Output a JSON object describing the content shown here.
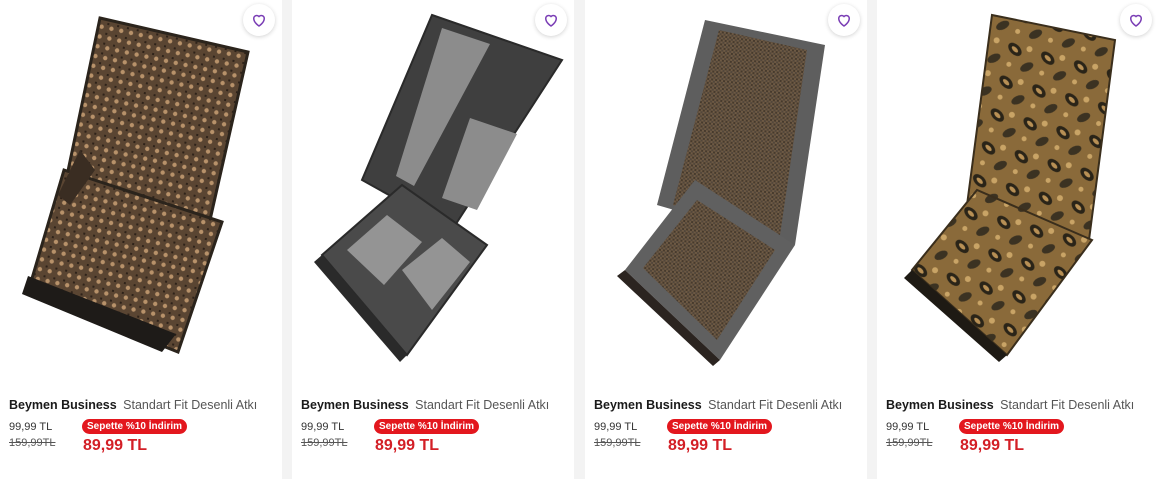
{
  "products": [
    {
      "brand": "Beymen Business",
      "name": "Standart Fit Desenli Atkı",
      "price_original": "99,99 TL",
      "price_list": "159,99TL",
      "badge": "Sepette %10 İndirim",
      "price_final": "89,99 TL",
      "image_desc": "brown scarf with dotted pattern",
      "favorite_icon": "heart-icon"
    },
    {
      "brand": "Beymen Business",
      "name": "Standart Fit Desenli Atkı",
      "price_original": "99,99 TL",
      "price_list": "159,99TL",
      "badge": "Sepette %10 İndirim",
      "price_final": "89,99 TL",
      "image_desc": "grey checked block scarf",
      "favorite_icon": "heart-icon"
    },
    {
      "brand": "Beymen Business",
      "name": "Standart Fit Desenli Atkı",
      "price_original": "99,99 TL",
      "price_list": "159,99TL",
      "badge": "Sepette %10 İndirim",
      "price_final": "89,99 TL",
      "image_desc": "grey houndstooth scarf",
      "favorite_icon": "heart-icon"
    },
    {
      "brand": "Beymen Business",
      "name": "Standart Fit Desenli Atkı",
      "price_original": "99,99 TL",
      "price_list": "159,99TL",
      "badge": "Sepette %10 İndirim",
      "price_final": "89,99 TL",
      "image_desc": "gold paisley scarf",
      "favorite_icon": "heart-icon"
    }
  ],
  "colors": {
    "badge": "#e3171e",
    "price": "#d31f26",
    "heart": "#7a3db5"
  }
}
